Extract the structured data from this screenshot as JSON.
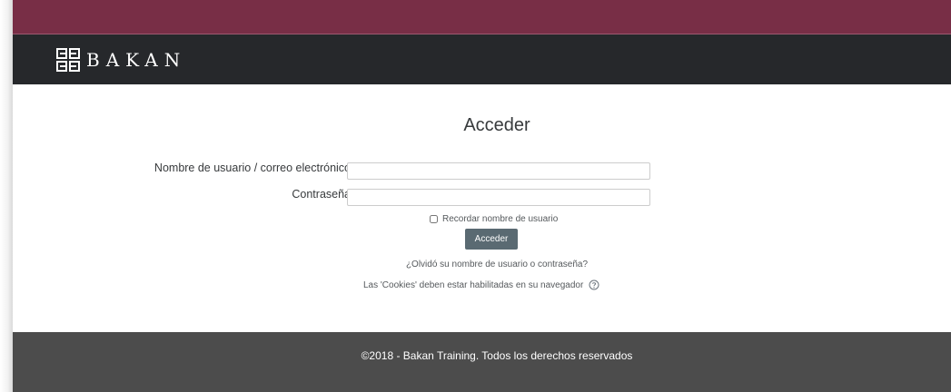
{
  "brand": {
    "name": "BAKAN",
    "colors": {
      "topbar": "#782e46",
      "navbar": "#26282b",
      "footer": "#4c4c4c",
      "button": "#5a6a72"
    }
  },
  "login": {
    "title": "Acceder",
    "username_label": "Nombre de usuario / correo electrónico",
    "username_value": "",
    "password_label": "Contraseña",
    "password_value": "",
    "remember_label": "Recordar nombre de usuario",
    "remember_checked": false,
    "submit_label": "Acceder",
    "forgot_link": "¿Olvidó su nombre de usuario o contraseña?",
    "cookies_notice": "Las 'Cookies' deben estar habilitadas en su navegador",
    "help_icon": "question-circle-icon"
  },
  "footer": {
    "copyright": "©2018 - Bakan Training. Todos los derechos reservados"
  }
}
